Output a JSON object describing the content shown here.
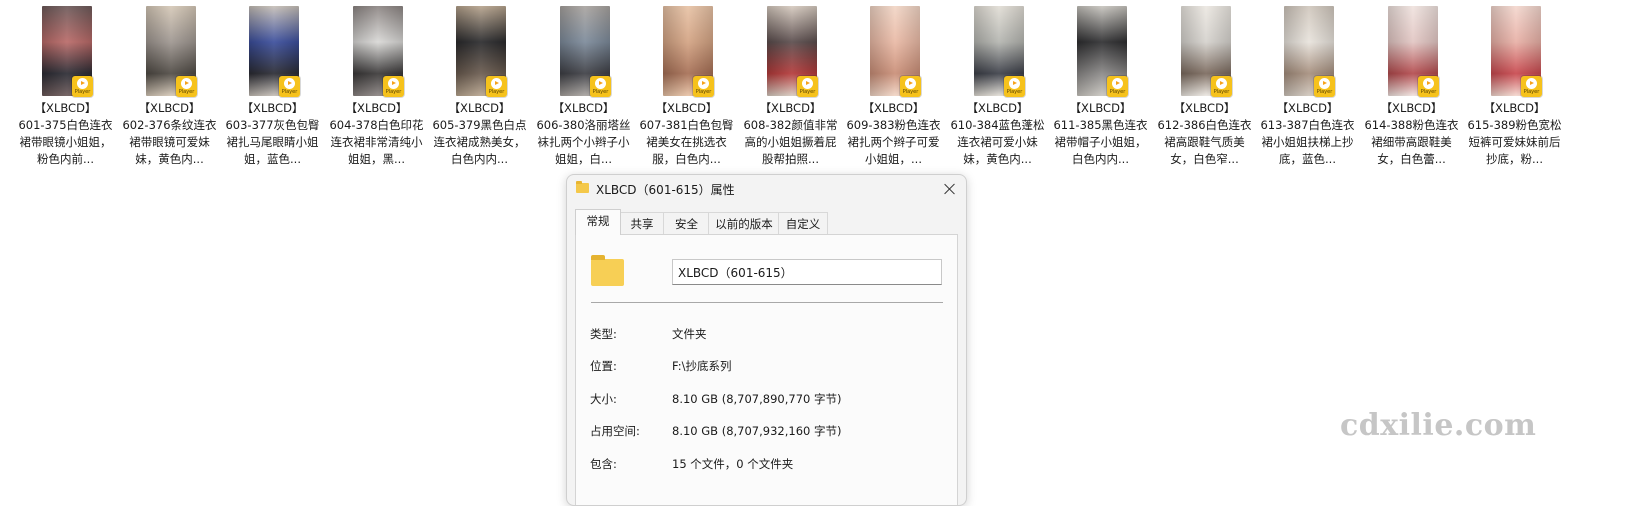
{
  "files": [
    {
      "tag": "【XLBCD】",
      "name": "601-375白色连衣裙带眼镜小姐姐，粉色内前...",
      "colors": [
        "#b96a68",
        "#2b2b33",
        "#6d5a5a"
      ]
    },
    {
      "tag": "【XLBCD】",
      "name": "602-376条纹连衣裙带眼镜可爱妹妹，黄色内...",
      "colors": [
        "#9e9690",
        "#4f4a44",
        "#d6c9b8"
      ]
    },
    {
      "tag": "【XLBCD】",
      "name": "603-377灰色包臀裙扎马尾眼睛小姐姐，蓝色...",
      "colors": [
        "#3b4e9c",
        "#2a2b33",
        "#c7c0b8"
      ]
    },
    {
      "tag": "【XLBCD】",
      "name": "604-378白色印花连衣裙非常清纯小姐姐，黑...",
      "colors": [
        "#d9d8d6",
        "#3a3838",
        "#8c8583"
      ]
    },
    {
      "tag": "【XLBCD】",
      "name": "605-379黑色白点连衣裙成熟美女，白色内内...",
      "colors": [
        "#2a2a2c",
        "#6a5b4f",
        "#b8a58f"
      ]
    },
    {
      "tag": "【XLBCD】",
      "name": "606-380洛丽塔丝袜扎两个小辫子小姐姐，白...",
      "colors": [
        "#7c8a9a",
        "#3e3f45",
        "#a9a4a0"
      ]
    },
    {
      "tag": "【XLBCD】",
      "name": "607-381白色包臀裙美女在挑选衣服，白色内...",
      "colors": [
        "#d3a383",
        "#a66f55",
        "#e8c3a6"
      ]
    },
    {
      "tag": "【XLBCD】",
      "name": "608-382颜值非常高的小姐姐撅着屁股帮拍照...",
      "colors": [
        "#5a4c4c",
        "#b43a3a",
        "#d7cbc0"
      ]
    },
    {
      "tag": "【XLBCD】",
      "name": "609-383粉色连衣裙扎两个辫子可爱小姐姐，...",
      "colors": [
        "#e9b9a5",
        "#c98e77",
        "#f2d6c6"
      ]
    },
    {
      "tag": "【XLBCD】",
      "name": "610-384蓝色蓬松连衣裙可爱小妹妹，黄色内...",
      "colors": [
        "#b4b5b0",
        "#3c3f48",
        "#e2ded6"
      ]
    },
    {
      "tag": "【XLBCD】",
      "name": "611-385黑色连衣裙带帽子小姐姐，白色内内...",
      "colors": [
        "#2e2e30",
        "#8a8887",
        "#c9c6c0"
      ]
    },
    {
      "tag": "【XLBCD】",
      "name": "612-386白色连衣裙高跟鞋气质美女，白色窄...",
      "colors": [
        "#d5d2cd",
        "#7b6a5e",
        "#ece8e2"
      ]
    },
    {
      "tag": "【XLBCD】",
      "name": "613-387白色连衣裙小姐姐扶梯上抄底，蓝色...",
      "colors": [
        "#e8e3dc",
        "#a58e7d",
        "#d0c7bd"
      ]
    },
    {
      "tag": "【XLBCD】",
      "name": "614-388粉色连衣裙细带高跟鞋美女，白色蕾...",
      "colors": [
        "#e2c6c3",
        "#b34a4d",
        "#f0e3df"
      ]
    },
    {
      "tag": "【XLBCD】",
      "name": "615-389粉色宽松短裤可爱妹妹前后抄底，粉...",
      "colors": [
        "#e8b0a6",
        "#c8484e",
        "#f4d8cf"
      ]
    }
  ],
  "badge_label": "Player",
  "dialog": {
    "title": "XLBCD（601-615）属性",
    "tabs": [
      "常规",
      "共享",
      "安全",
      "以前的版本",
      "自定义"
    ],
    "active_tab": "常规",
    "folder_name": "XLBCD（601-615）",
    "props": [
      {
        "key": "类型:",
        "value": "文件夹"
      },
      {
        "key": "位置:",
        "value": "F:\\抄底系列"
      },
      {
        "key": "大小:",
        "value": "8.10 GB (8,707,890,770 字节)"
      },
      {
        "key": "占用空间:",
        "value": "8.10 GB (8,707,932,160 字节)"
      },
      {
        "key": "包含:",
        "value": "15 个文件，0 个文件夹"
      }
    ]
  },
  "watermark": "cdxilie.com"
}
